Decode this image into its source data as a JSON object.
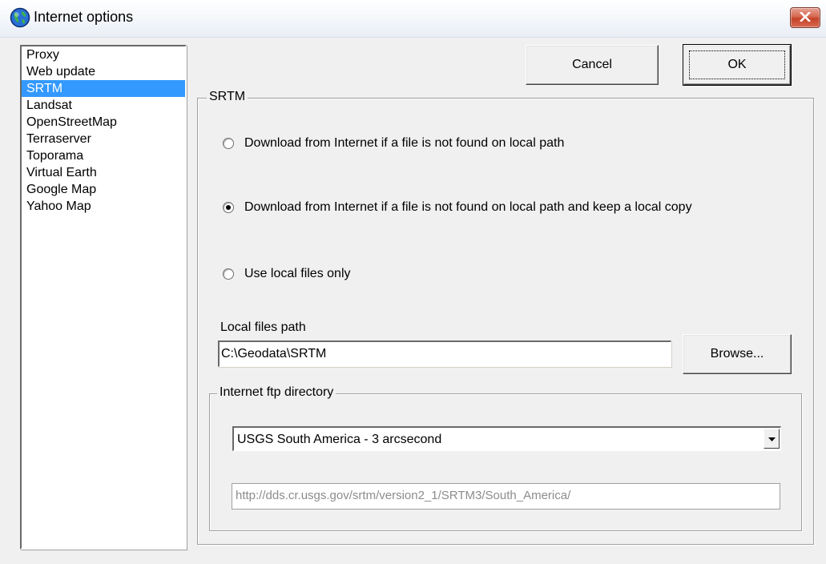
{
  "window": {
    "title": "Internet options",
    "close_icon": "close-icon"
  },
  "sidebar": {
    "items": [
      {
        "label": "Proxy",
        "selected": false
      },
      {
        "label": "Web update",
        "selected": false
      },
      {
        "label": "SRTM",
        "selected": true
      },
      {
        "label": "Landsat",
        "selected": false
      },
      {
        "label": "OpenStreetMap",
        "selected": false
      },
      {
        "label": "Terraserver",
        "selected": false
      },
      {
        "label": "Toporama",
        "selected": false
      },
      {
        "label": "Virtual Earth",
        "selected": false
      },
      {
        "label": "Google Map",
        "selected": false
      },
      {
        "label": "Yahoo Map",
        "selected": false
      }
    ]
  },
  "buttons": {
    "cancel": "Cancel",
    "ok": "OK",
    "browse": "Browse..."
  },
  "srtm": {
    "group_title": "SRTM",
    "options": [
      {
        "label": "Download from Internet if a file is not found on local path",
        "checked": false
      },
      {
        "label": "Download from Internet if a file is not found on local path and keep a local copy",
        "checked": true
      },
      {
        "label": "Use local files only",
        "checked": false
      }
    ],
    "local_path_label": "Local files path",
    "local_path_value": "C:\\Geodata\\SRTM",
    "ftp": {
      "group_title": "Internet ftp directory",
      "selected": "USGS South America - 3 arcsecond",
      "url": "http://dds.cr.usgs.gov/srtm/version2_1/SRTM3/South_America/"
    }
  },
  "colors": {
    "selection": "#3399ff",
    "dialog_bg": "#f0f0f0",
    "close_button": "#c4432a"
  }
}
